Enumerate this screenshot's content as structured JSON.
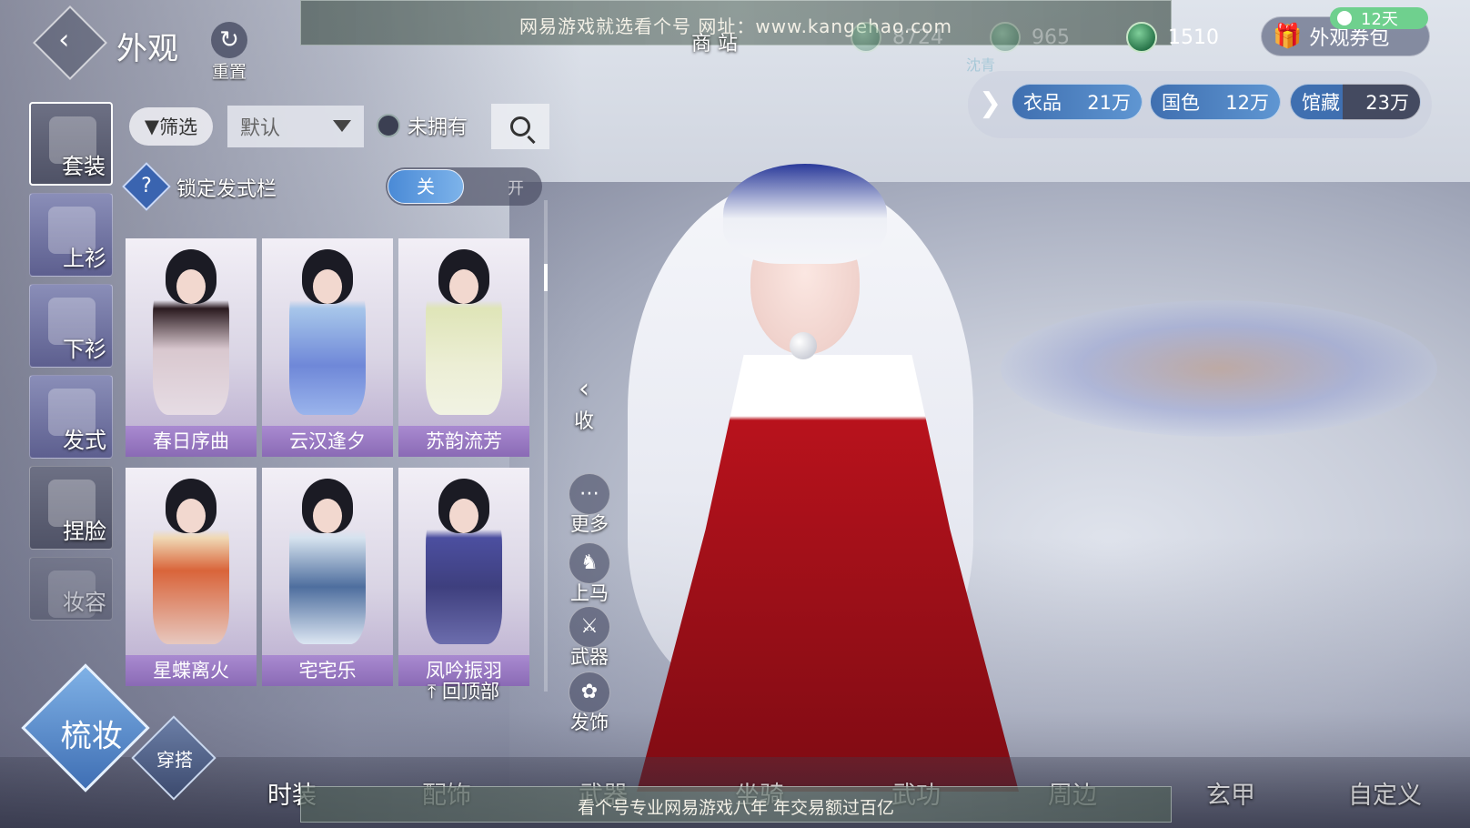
{
  "header": {
    "title": "外观",
    "reset_label": "重置",
    "banner_text": "网易游戏就选看个号  网址：www.kangehao.com",
    "shop_label": "商  站",
    "sub_label": "沈青",
    "currencies": [
      {
        "value": "8724",
        "icon": "jade-coin-icon"
      },
      {
        "value": "965",
        "icon": "jade-coin-icon"
      },
      {
        "value": "1510",
        "icon": "jade-coin-icon"
      }
    ],
    "voucher_label": "外观券包",
    "voucher_badge": "12天"
  },
  "stats": [
    {
      "label": "衣品",
      "value": "21万"
    },
    {
      "label": "国色",
      "value": "12万"
    },
    {
      "label": "馆藏",
      "value": "23万"
    }
  ],
  "side_tabs": [
    {
      "label": "套装",
      "active": true
    },
    {
      "label": "上衫"
    },
    {
      "label": "下衫"
    },
    {
      "label": "发式"
    },
    {
      "label": "捏脸"
    },
    {
      "label": "妆容"
    }
  ],
  "filter": {
    "filter_label": "筛选",
    "sort_value": "默认",
    "owned_label": "未拥有"
  },
  "lock": {
    "label": "锁定发式栏",
    "off_label": "关",
    "on_label": "开"
  },
  "items": [
    {
      "name": "春日序曲"
    },
    {
      "name": "云汉逢夕"
    },
    {
      "name": "苏韵流芳"
    },
    {
      "name": "星蝶离火"
    },
    {
      "name": "宅宅乐"
    },
    {
      "name": "凤吟振羽"
    }
  ],
  "to_top_label": "回顶部",
  "collapse_label": "收",
  "actions": [
    {
      "label": "更多",
      "icon": "more-icon"
    },
    {
      "label": "上马",
      "icon": "horse-icon"
    },
    {
      "label": "武器",
      "icon": "weapon-icon"
    },
    {
      "label": "发饰",
      "icon": "hair-accessory-icon"
    }
  ],
  "bottom_tabs": [
    {
      "label": "时装",
      "active": true
    },
    {
      "label": "配饰"
    },
    {
      "label": "武器"
    },
    {
      "label": "坐骑"
    },
    {
      "label": "武功"
    },
    {
      "label": "周边"
    },
    {
      "label": "玄甲"
    },
    {
      "label": "自定义"
    }
  ],
  "bottom_banner_text": "看个号专业网易游戏八年  年交易额过百亿",
  "modes": {
    "main": "梳妆",
    "sub": "穿搭"
  }
}
